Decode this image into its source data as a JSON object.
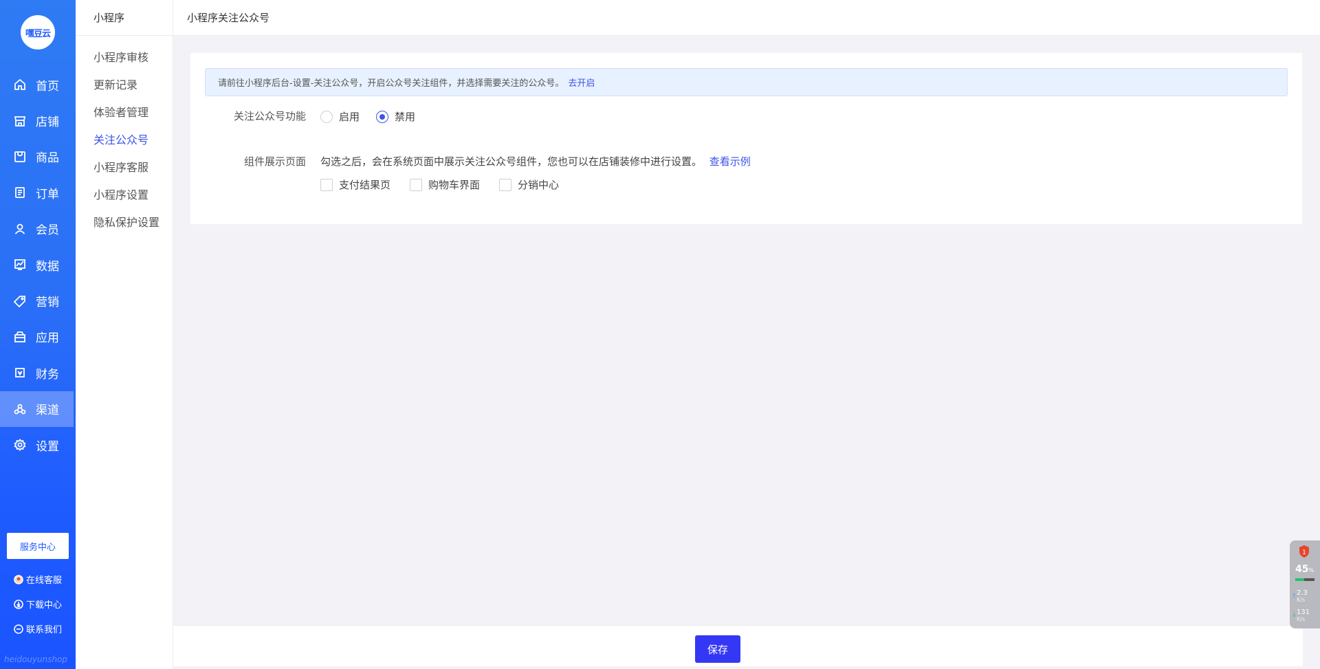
{
  "sidebar": {
    "logo_text": "嘿豆云",
    "items": [
      {
        "label": "首页",
        "icon": "home-icon"
      },
      {
        "label": "店铺",
        "icon": "store-icon"
      },
      {
        "label": "商品",
        "icon": "goods-icon"
      },
      {
        "label": "订单",
        "icon": "order-icon"
      },
      {
        "label": "会员",
        "icon": "member-icon"
      },
      {
        "label": "数据",
        "icon": "chart-icon"
      },
      {
        "label": "营销",
        "icon": "tag-icon"
      },
      {
        "label": "应用",
        "icon": "app-box-icon"
      },
      {
        "label": "财务",
        "icon": "finance-icon"
      },
      {
        "label": "渠道",
        "icon": "channel-icon"
      },
      {
        "label": "设置",
        "icon": "gear-icon"
      }
    ],
    "active_index": 9,
    "service_button": "服务中心",
    "footer_links": [
      {
        "label": "在线客服",
        "icon": "avatar-icon"
      },
      {
        "label": "下载中心",
        "icon": "download-icon"
      },
      {
        "label": "联系我们",
        "icon": "chat-icon"
      }
    ],
    "brand_footer": "heidouyunshop"
  },
  "submenu": {
    "title": "小程序",
    "items": [
      "小程序审核",
      "更新记录",
      "体验者管理",
      "关注公众号",
      "小程序客服",
      "小程序设置",
      "隐私保护设置"
    ],
    "active_index": 3
  },
  "topbar": {
    "breadcrumb": "小程序关注公众号"
  },
  "notice": {
    "text": "请前往小程序后台-设置-关注公众号，开启公众号关注组件，并选择需要关注的公众号。",
    "link": "去开启"
  },
  "form": {
    "follow_label": "关注公众号功能",
    "follow_options": [
      "启用",
      "禁用"
    ],
    "follow_selected": "禁用",
    "display_label": "组件展示页面",
    "display_desc": "勾选之后，会在系统页面中展示关注公众号组件，您也可以在店铺装修中进行设置。",
    "display_link": "查看示例",
    "display_options": [
      "支付结果页",
      "购物车界面",
      "分销中心"
    ]
  },
  "footer": {
    "save": "保存"
  },
  "monitor": {
    "badge": "1",
    "cpu_value": "45",
    "cpu_unit": "%",
    "cpu_fraction": 0.45,
    "up_value": "2.3",
    "up_unit": "K/s",
    "down_value": "131",
    "down_unit": "K/s",
    "colors": {
      "shield": "#e8452c",
      "bar": "#26c26b"
    }
  }
}
